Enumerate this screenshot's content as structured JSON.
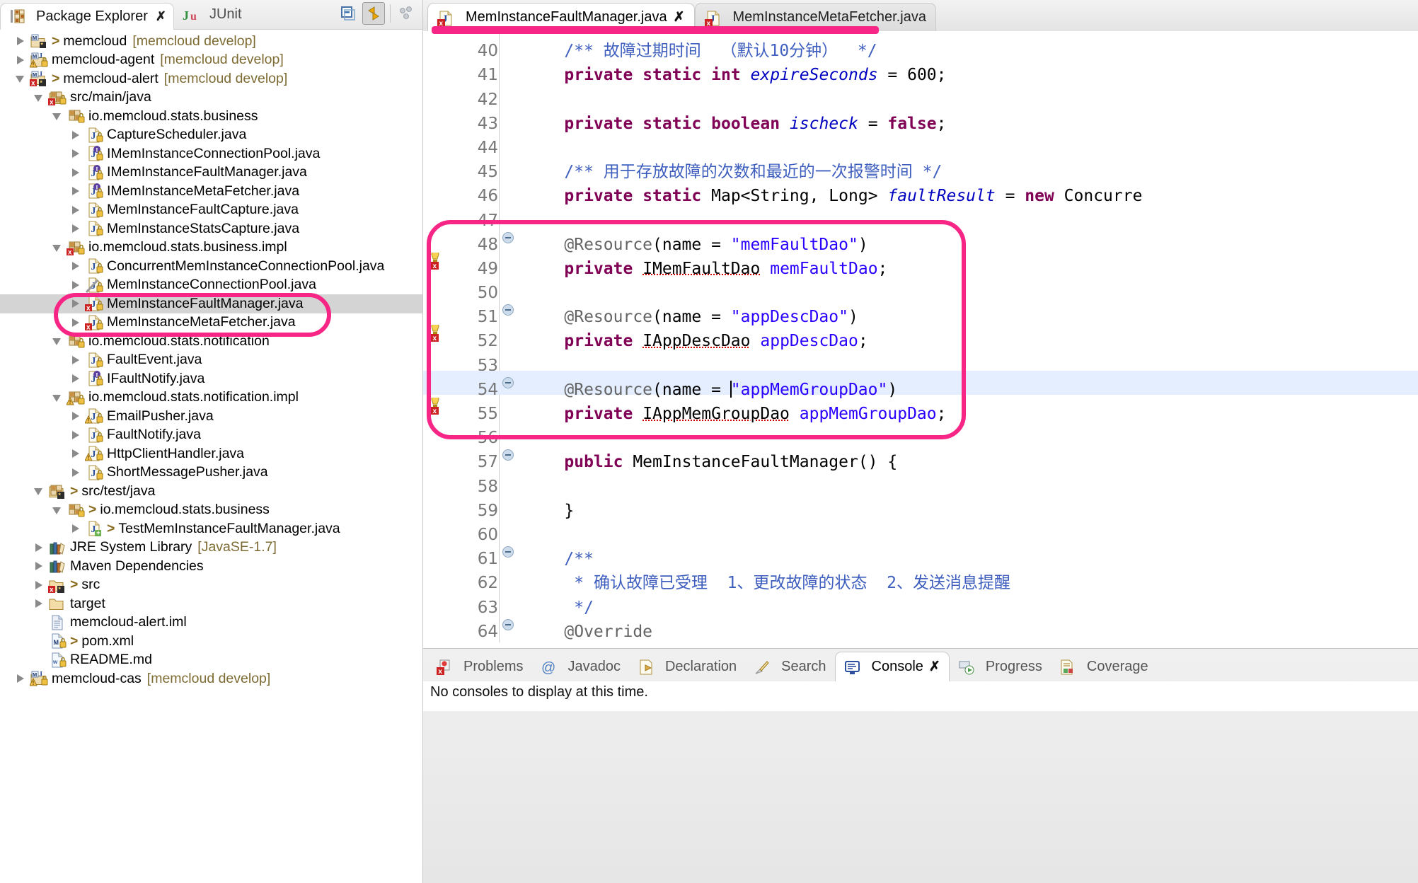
{
  "left_panel": {
    "tabs": [
      {
        "label": "Package Explorer",
        "icon": "package-explorer-icon",
        "active": true,
        "close": "✗"
      },
      {
        "label": "JUnit",
        "icon": "junit-icon",
        "active": false
      }
    ],
    "toolbar": [
      {
        "name": "collapse-all-button",
        "icon": "collapse-all-icon"
      },
      {
        "name": "link-with-editor-button",
        "icon": "link-editor-icon",
        "pressed": true
      },
      {
        "name": "view-menu-button",
        "icon": "view-menu-icon"
      }
    ],
    "tree": [
      {
        "indent": 0,
        "arrow": "collapsed",
        "icon": "java-project-icon",
        "gt": ">",
        "label": "memcloud",
        "suffix": "[memcloud develop]"
      },
      {
        "indent": 0,
        "arrow": "collapsed",
        "icon": "java-project-warn-icon",
        "label": "memcloud-agent",
        "suffix": "[memcloud develop]"
      },
      {
        "indent": 0,
        "arrow": "expanded",
        "icon": "java-project-error-icon",
        "gt": ">",
        "label": "memcloud-alert",
        "suffix": "[memcloud develop]"
      },
      {
        "indent": 1,
        "arrow": "expanded",
        "icon": "source-folder-error-icon",
        "label": "src/main/java"
      },
      {
        "indent": 2,
        "arrow": "expanded",
        "icon": "package-icon",
        "label": "io.memcloud.stats.business"
      },
      {
        "indent": 3,
        "arrow": "collapsed",
        "icon": "java-class-icon",
        "label": "CaptureScheduler.java"
      },
      {
        "indent": 3,
        "arrow": "collapsed",
        "icon": "java-interface-icon",
        "label": "IMemInstanceConnectionPool.java"
      },
      {
        "indent": 3,
        "arrow": "collapsed",
        "icon": "java-interface-icon",
        "label": "IMemInstanceFaultManager.java"
      },
      {
        "indent": 3,
        "arrow": "collapsed",
        "icon": "java-interface-icon",
        "label": "IMemInstanceMetaFetcher.java"
      },
      {
        "indent": 3,
        "arrow": "collapsed",
        "icon": "java-class-icon",
        "label": "MemInstanceFaultCapture.java"
      },
      {
        "indent": 3,
        "arrow": "collapsed",
        "icon": "java-class-icon",
        "label": "MemInstanceStatsCapture.java"
      },
      {
        "indent": 2,
        "arrow": "expanded",
        "icon": "package-error-icon",
        "label": "io.memcloud.stats.business.impl"
      },
      {
        "indent": 3,
        "arrow": "collapsed",
        "icon": "java-class-icon",
        "label": "ConcurrentMemInstanceConnectionPool.java"
      },
      {
        "indent": 3,
        "arrow": "collapsed",
        "icon": "java-class-edited-icon",
        "label": "MemInstanceConnectionPool.java"
      },
      {
        "indent": 3,
        "arrow": "collapsed",
        "icon": "java-class-error-icon",
        "label": "MemInstanceFaultManager.java",
        "selected": true
      },
      {
        "indent": 3,
        "arrow": "collapsed",
        "icon": "java-class-error-icon",
        "label": "MemInstanceMetaFetcher.java"
      },
      {
        "indent": 2,
        "arrow": "expanded",
        "icon": "package-icon",
        "label": "io.memcloud.stats.notification"
      },
      {
        "indent": 3,
        "arrow": "collapsed",
        "icon": "java-class-icon",
        "label": "FaultEvent.java"
      },
      {
        "indent": 3,
        "arrow": "collapsed",
        "icon": "java-interface-icon",
        "label": "IFaultNotify.java"
      },
      {
        "indent": 2,
        "arrow": "expanded",
        "icon": "package-warn-icon",
        "label": "io.memcloud.stats.notification.impl"
      },
      {
        "indent": 3,
        "arrow": "collapsed",
        "icon": "java-class-warn-icon",
        "label": "EmailPusher.java"
      },
      {
        "indent": 3,
        "arrow": "collapsed",
        "icon": "java-class-icon",
        "label": "FaultNotify.java"
      },
      {
        "indent": 3,
        "arrow": "collapsed",
        "icon": "java-class-warn-icon",
        "label": "HttpClientHandler.java"
      },
      {
        "indent": 3,
        "arrow": "collapsed",
        "icon": "java-class-icon",
        "label": "ShortMessagePusher.java"
      },
      {
        "indent": 1,
        "arrow": "expanded",
        "icon": "source-folder-icon",
        "gt": ">",
        "label": "src/test/java"
      },
      {
        "indent": 2,
        "arrow": "expanded",
        "icon": "package-icon",
        "gt": ">",
        "label": "io.memcloud.stats.business"
      },
      {
        "indent": 3,
        "arrow": "collapsed",
        "icon": "java-class-new-icon",
        "gt": ">",
        "label": "TestMemInstanceFaultManager.java"
      },
      {
        "indent": 1,
        "arrow": "collapsed",
        "icon": "library-icon",
        "label": "JRE System Library",
        "suffix": "[JavaSE-1.7]"
      },
      {
        "indent": 1,
        "arrow": "collapsed",
        "icon": "library-icon",
        "label": "Maven Dependencies"
      },
      {
        "indent": 1,
        "arrow": "collapsed",
        "icon": "folder-error-icon",
        "gt": ">",
        "label": "src"
      },
      {
        "indent": 1,
        "arrow": "collapsed",
        "icon": "folder-icon",
        "label": "target"
      },
      {
        "indent": 1,
        "arrow": "none",
        "icon": "iml-file-icon",
        "label": "memcloud-alert.iml"
      },
      {
        "indent": 1,
        "arrow": "none",
        "icon": "pom-file-icon",
        "gt": ">",
        "label": "pom.xml"
      },
      {
        "indent": 1,
        "arrow": "none",
        "icon": "readme-file-icon",
        "label": "README.md"
      },
      {
        "indent": 0,
        "arrow": "collapsed",
        "icon": "java-project-warn-icon",
        "label": "memcloud-cas",
        "suffix": "[memcloud develop]"
      }
    ]
  },
  "editor": {
    "tabs": [
      {
        "label": "MemInstanceFaultManager.java",
        "icon": "java-class-error-icon",
        "active": true,
        "close": "✗"
      },
      {
        "label": "MemInstanceMetaFetcher.java",
        "icon": "java-class-error-icon",
        "active": false
      }
    ],
    "lines": [
      {
        "no": "40",
        "fold": false,
        "marker": "",
        "html": "    <span class=\"cm\">/** 故障过期时间  （默认10分钟）  */</span>"
      },
      {
        "no": "41",
        "fold": false,
        "marker": "",
        "html": "    <span class=\"k\">private</span> <span class=\"k\">static</span> <span class=\"k\">int</span> <span class=\"f\">expireSeconds</span> = <span class=\"cnum\">600</span>;"
      },
      {
        "no": "42",
        "fold": false,
        "marker": "",
        "html": ""
      },
      {
        "no": "43",
        "fold": false,
        "marker": "",
        "html": "    <span class=\"k\">private</span> <span class=\"k\">static</span> <span class=\"k\">boolean</span> <span class=\"f\">ischeck</span> = <span class=\"k\">false</span>;"
      },
      {
        "no": "44",
        "fold": false,
        "marker": "",
        "html": ""
      },
      {
        "no": "45",
        "fold": false,
        "marker": "",
        "html": "    <span class=\"cm\">/** 用于存放故障的次数和最近的一次报警时间 */</span>"
      },
      {
        "no": "46",
        "fold": false,
        "marker": "",
        "html": "    <span class=\"k\">private</span> <span class=\"k\">static</span> Map&lt;String, Long&gt; <span class=\"f\">faultResult</span> = <span class=\"k\">new</span> Concurre"
      },
      {
        "no": "47",
        "fold": false,
        "marker": "",
        "html": ""
      },
      {
        "no": "48",
        "fold": true,
        "marker": "",
        "html": "    <span class=\"an\">@Resource</span>(name = <span class=\"s\">\"memFaultDao\"</span>)"
      },
      {
        "no": "49",
        "fold": false,
        "marker": "error",
        "html": "    <span class=\"k\">private</span> <span class=\"err\">IMemFaultDao</span> <span class=\"s\">memFaultDao</span>;"
      },
      {
        "no": "50",
        "fold": false,
        "marker": "",
        "html": ""
      },
      {
        "no": "51",
        "fold": true,
        "marker": "",
        "html": "    <span class=\"an\">@Resource</span>(name = <span class=\"s\">\"appDescDao\"</span>)"
      },
      {
        "no": "52",
        "fold": false,
        "marker": "error",
        "html": "    <span class=\"k\">private</span> <span class=\"err\">IAppDescDao</span> <span class=\"s\">appDescDao</span>;"
      },
      {
        "no": "53",
        "fold": false,
        "marker": "",
        "html": ""
      },
      {
        "no": "54",
        "fold": true,
        "marker": "cursor-line",
        "highlight": true,
        "html": "    <span class=\"an\">@Resource</span>(name = <span class=\"cursor\"></span><span class=\"s\">\"appMemGroupDao\"</span>)"
      },
      {
        "no": "55",
        "fold": false,
        "marker": "error",
        "html": "    <span class=\"k\">private</span> <span class=\"err\">IAppMemGroupDao</span> <span class=\"s\">appMemGroupDao</span>;"
      },
      {
        "no": "56",
        "fold": false,
        "marker": "",
        "html": ""
      },
      {
        "no": "57",
        "fold": true,
        "marker": "",
        "html": "    <span class=\"k\">public</span> MemInstanceFaultManager() {"
      },
      {
        "no": "58",
        "fold": false,
        "marker": "",
        "html": ""
      },
      {
        "no": "59",
        "fold": false,
        "marker": "",
        "html": "    }"
      },
      {
        "no": "60",
        "fold": false,
        "marker": "",
        "html": ""
      },
      {
        "no": "61",
        "fold": true,
        "marker": "",
        "html": "    <span class=\"cm\">/**</span>"
      },
      {
        "no": "62",
        "fold": false,
        "marker": "",
        "html": "     <span class=\"cm\">* 确认故障已受理  1、更改故障的状态  2、发送消息提醒</span>"
      },
      {
        "no": "63",
        "fold": false,
        "marker": "",
        "html": "     <span class=\"cm\">*/</span>"
      },
      {
        "no": "64",
        "fold": true,
        "marker": "",
        "html": "    <span class=\"an\">@Override</span>"
      }
    ],
    "raw_lines": [
      "    /** 故障过期时间  （默认10分钟）  */",
      "    private static int expireSeconds = 600;",
      "",
      "    private static boolean ischeck = false;",
      "",
      "    /** 用于存放故障的次数和最近的一次报警时间 */",
      "    private static Map<String, Long> faultResult = new Concurre",
      "",
      "    @Resource(name = \"memFaultDao\")",
      "    private IMemFaultDao memFaultDao;",
      "",
      "    @Resource(name = \"appDescDao\")",
      "    private IAppDescDao appDescDao;",
      "",
      "    @Resource(name = \"appMemGroupDao\")",
      "    private IAppMemGroupDao appMemGroupDao;",
      "",
      "    public MemInstanceFaultManager() {",
      "",
      "    }",
      "",
      "    /**",
      "     * 确认故障已受理  1、更改故障的状态  2、发送消息提醒",
      "     */",
      "    @Override"
    ]
  },
  "bottom_panel": {
    "tabs": [
      {
        "label": "Problems",
        "icon": "problems-icon",
        "active": false
      },
      {
        "label": "Javadoc",
        "icon": "javadoc-icon",
        "active": false
      },
      {
        "label": "Declaration",
        "icon": "declaration-icon",
        "active": false
      },
      {
        "label": "Search",
        "icon": "search-icon",
        "active": false
      },
      {
        "label": "Console",
        "icon": "console-icon",
        "active": true,
        "close": "✗"
      },
      {
        "label": "Progress",
        "icon": "progress-icon",
        "active": false
      },
      {
        "label": "Coverage",
        "icon": "coverage-icon",
        "active": false
      }
    ],
    "console_message": "No consoles to display at this time."
  },
  "annotations": {
    "accent_color": "#f72585",
    "highlights": [
      {
        "name": "tree-files-highlight",
        "type": "rect"
      },
      {
        "name": "code-block-highlight",
        "type": "rect"
      },
      {
        "name": "editor-tab-underline",
        "type": "bar"
      }
    ]
  }
}
